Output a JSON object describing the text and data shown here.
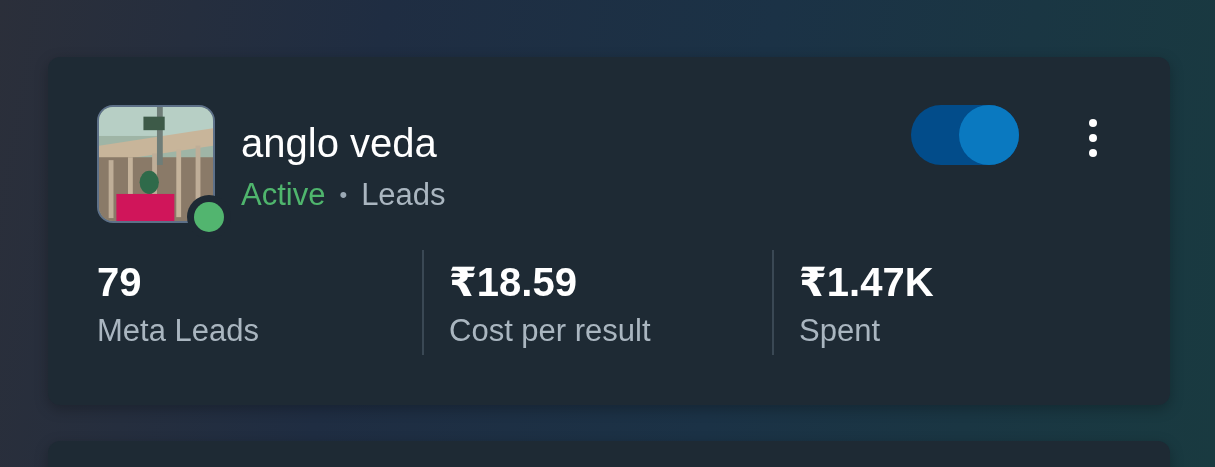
{
  "campaign": {
    "name": "anglo veda",
    "active": true,
    "status": "Active",
    "separator": "•",
    "objective": "Leads",
    "toggle": {
      "on": true
    },
    "stats": [
      {
        "value": "79",
        "label": "Meta Leads"
      },
      {
        "value": "₹18.59",
        "label": "Cost per result"
      },
      {
        "value": "₹1.47K",
        "label": "Spent"
      }
    ]
  },
  "next_card": {
    "kind": "card"
  }
}
